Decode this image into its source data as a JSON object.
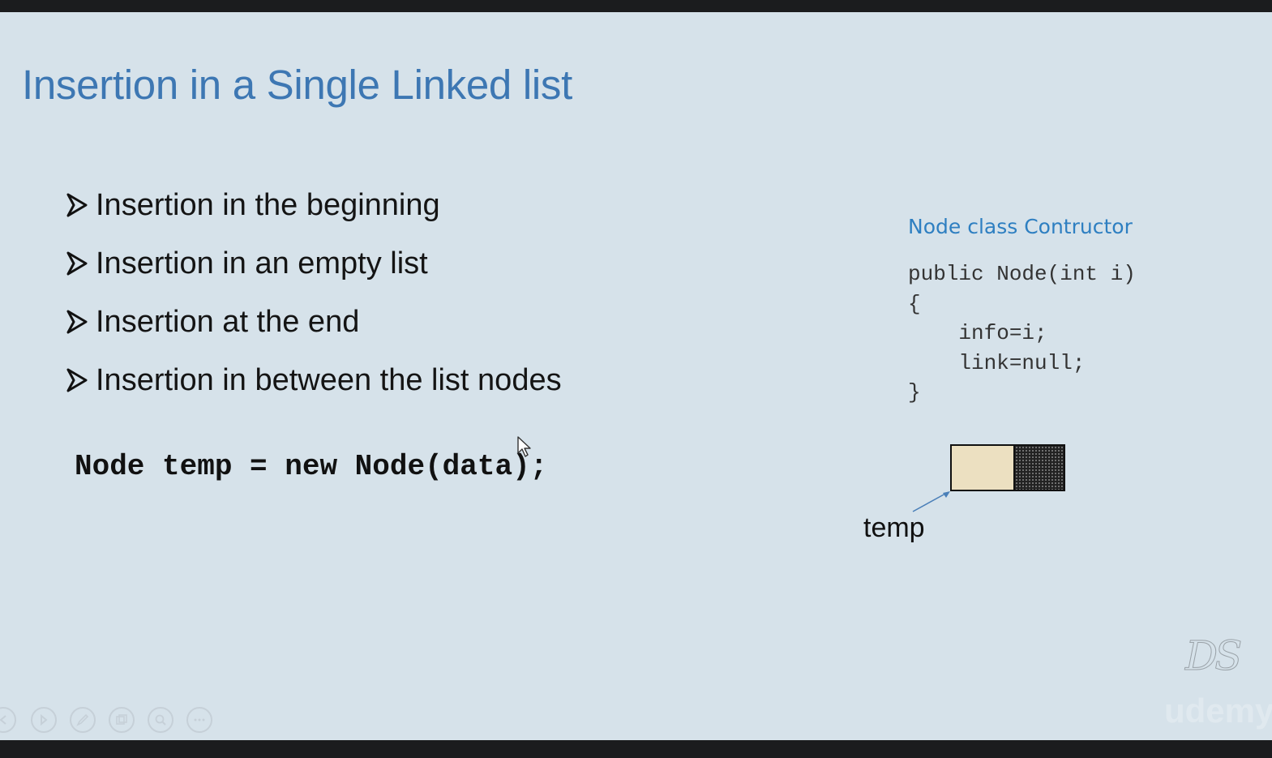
{
  "slide": {
    "title": "Insertion in a Single Linked list",
    "bullets": [
      {
        "label": "Insertion in the beginning"
      },
      {
        "label": "Insertion in an empty list"
      },
      {
        "label": "Insertion at the end"
      },
      {
        "label": "Insertion in between the list nodes"
      }
    ],
    "code_line": "Node temp = new Node(data);",
    "constructor": {
      "heading": "Node class Contructor",
      "lines": [
        "public Node(int i)",
        "{",
        "    info=i;",
        "    link=null;",
        "}"
      ]
    },
    "diagram": {
      "pointer_label": "temp",
      "info_color": "#ece0c1",
      "link_color": "#222222"
    },
    "logo": "DS",
    "watermark": "udemy"
  },
  "colors": {
    "background": "#d6e2ea",
    "title": "#3d77b3",
    "heading": "#2e7fc1"
  },
  "controls": [
    {
      "name": "previous-slide-icon"
    },
    {
      "name": "next-slide-icon"
    },
    {
      "name": "pen-icon"
    },
    {
      "name": "slides-grid-icon"
    },
    {
      "name": "zoom-icon"
    },
    {
      "name": "more-options-icon"
    }
  ]
}
